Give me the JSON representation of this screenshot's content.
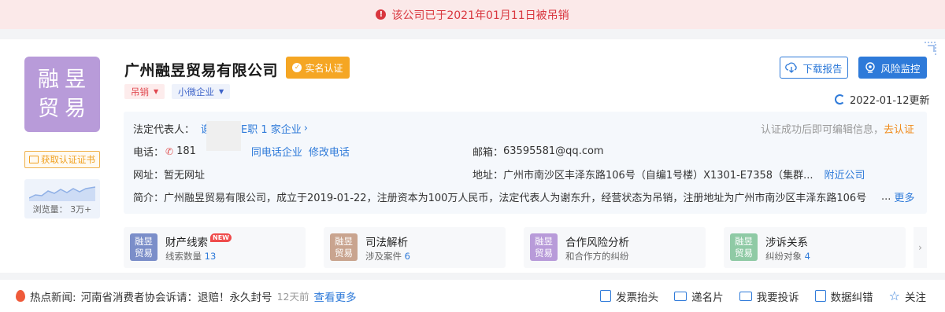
{
  "alert": {
    "text": "该公司已于2021年01月11日被吊销",
    "icon": "exclamation-icon"
  },
  "company": {
    "logo_line1": "融昱",
    "logo_line2": "贸易",
    "name": "广州融昱贸易有限公司",
    "verified_label": "实名认证",
    "tags": [
      {
        "label": "吊销"
      },
      {
        "label": "小微企业"
      }
    ],
    "cert_button": "获取认证证书",
    "views_label": "浏览量： 3万+"
  },
  "actions": {
    "download": "下载报告",
    "risk": "风险监控",
    "update": "2022-01-12更新"
  },
  "info": {
    "legal_label": "法定代表人：",
    "legal_name_visible": "谢",
    "legal_tenure": "E职 1 家企业",
    "cert_hint": "认证成功后即可编辑信息，",
    "cert_link": "去认证",
    "phone_label": "电话：",
    "phone_value": "181",
    "same_phone": "同电话企业",
    "edit_phone": "修改电话",
    "email_label": "邮箱：",
    "email_value": "63595581@qq.com",
    "website_label": "网址：",
    "website_value": "暂无网址",
    "address_label": "地址：",
    "address_value": "广州市南沙区丰泽东路106号（自编1号楼）X1301-E7358（集群...",
    "nearby": "附近公司",
    "intro_label": "简介：",
    "intro_value": "广州融昱贸易有限公司，成立于2019-01-22，注册资本为100万人民币，法定代表人为谢东升，经营状态为吊销，注册地址为广州市南沙区丰泽东路106号",
    "intro_more_dots": "...",
    "intro_more": "更多"
  },
  "modules": [
    {
      "title": "财产线索",
      "badge": "NEW",
      "sub": "线索数量",
      "count": "13",
      "color": "#7b8ec9"
    },
    {
      "title": "司法解析",
      "badge": "",
      "sub": "涉及案件",
      "count": "6",
      "color": "#c9a48f"
    },
    {
      "title": "合作风险分析",
      "badge": "",
      "sub": "和合作方的纠纷",
      "count": "",
      "color": "#b89bd9"
    },
    {
      "title": "涉诉关系",
      "badge": "",
      "sub": "纠纷对象",
      "count": "4",
      "color": "#8fcaa5"
    }
  ],
  "footer": {
    "news_label": "热点新闻:",
    "news_text": "河南省消费者协会诉请：退赔！永久封号",
    "news_time": "12天前",
    "news_more": "查看更多",
    "actions": [
      "发票抬头",
      "递名片",
      "我要投诉",
      "数据纠错",
      "关注"
    ]
  }
}
